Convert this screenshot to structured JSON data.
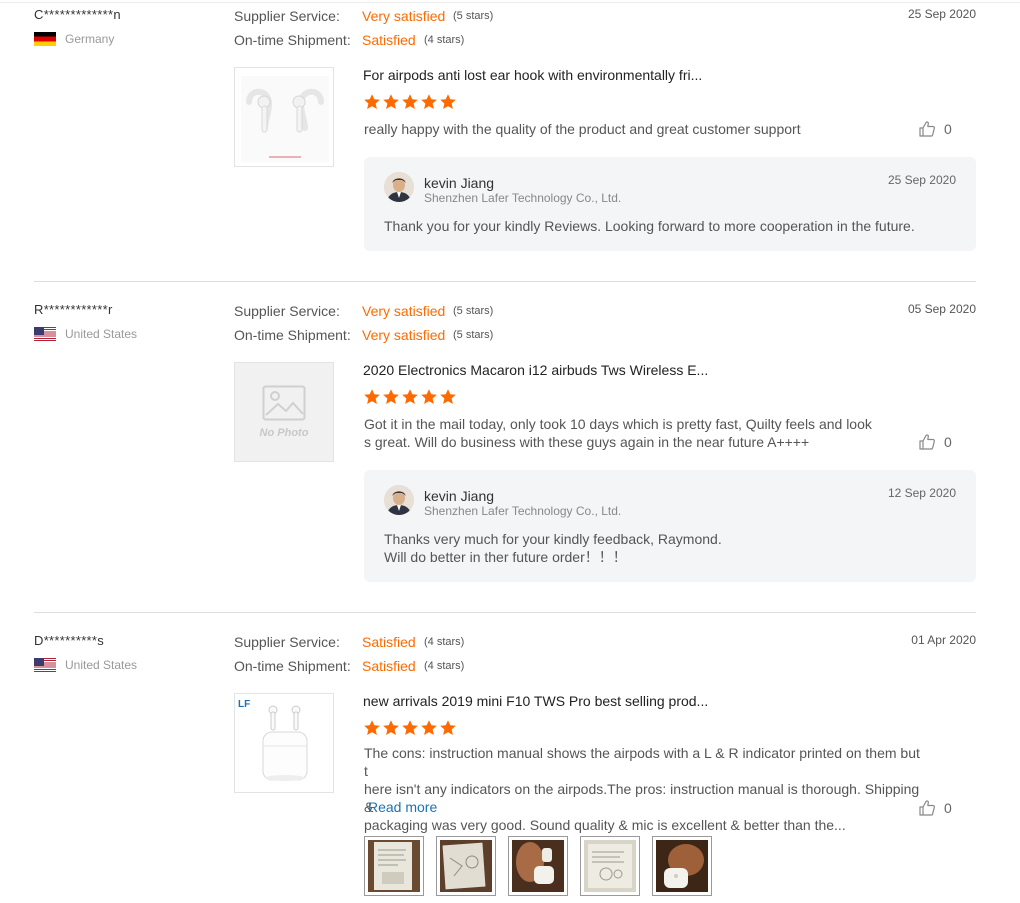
{
  "labels": {
    "supplier_service": "Supplier Service:",
    "ontime_shipment": "On-time Shipment:"
  },
  "colors": {
    "accent": "#ff6a00",
    "link": "#1a73b8"
  },
  "icons": {
    "like": "thumbs-up-icon",
    "star": "star-icon",
    "no_photo": "image-placeholder-icon"
  },
  "reviews": [
    {
      "buyer": "C*************n",
      "country": "Germany",
      "flag": "germany-flag-icon",
      "supplier_service": {
        "text": "Very satisfied",
        "stars": "(5 stars)"
      },
      "ontime_shipment": {
        "text": "Satisfied",
        "stars": "(4 stars)"
      },
      "date": "25 Sep 2020",
      "product_title": "For airpods anti lost ear hook with environmentally fri...",
      "rating": 5,
      "comment": "really happy with the quality of the product and great customer support",
      "likes": "0",
      "reply": {
        "name": "kevin Jiang",
        "company": "Shenzhen Lafer Technology Co., Ltd.",
        "date": "25 Sep 2020",
        "text": "Thank you for your kindly Reviews. Looking forward to more cooperation in the future."
      }
    },
    {
      "buyer": "R************r",
      "country": "United States",
      "flag": "usa-flag-icon",
      "supplier_service": {
        "text": "Very satisfied",
        "stars": "(5 stars)"
      },
      "ontime_shipment": {
        "text": "Very satisfied",
        "stars": "(5 stars)"
      },
      "date": "05 Sep 2020",
      "product_title": "2020 Electronics Macaron i12 airbuds Tws Wireless E...",
      "rating": 5,
      "no_photo_label": "No Photo",
      "comment_lines": [
        "Got it in the mail today, only took 10 days which is pretty fast, Quilty feels and look",
        "s great. Will do business with these guys again in the near future A++++"
      ],
      "likes": "0",
      "reply": {
        "name": "kevin Jiang",
        "company": "Shenzhen Lafer Technology Co., Ltd.",
        "date": "12 Sep 2020",
        "text_lines": [
          "Thanks very much for your kindly feedback, Raymond.",
          "Will do better in ther future order！！！"
        ]
      }
    },
    {
      "buyer": "D**********s",
      "country": "United States",
      "flag": "usa-flag-icon",
      "supplier_service": {
        "text": "Satisfied",
        "stars": "(4 stars)"
      },
      "ontime_shipment": {
        "text": "Satisfied",
        "stars": "(4 stars)"
      },
      "date": "01 Apr 2020",
      "product_title": "new arrivals 2019 mini F10 TWS Pro best selling prod...",
      "rating": 5,
      "comment_lines": [
        "The cons: instruction manual shows the airpods with a L & R indicator printed on them but t",
        "here isn't any indicators on the airpods.The pros: instruction manual is thorough. Shipping &",
        "packaging was very good. Sound quality & mic is excellent & better than the..."
      ],
      "read_more": "Read more",
      "likes": "0",
      "photos_count": 5
    }
  ]
}
